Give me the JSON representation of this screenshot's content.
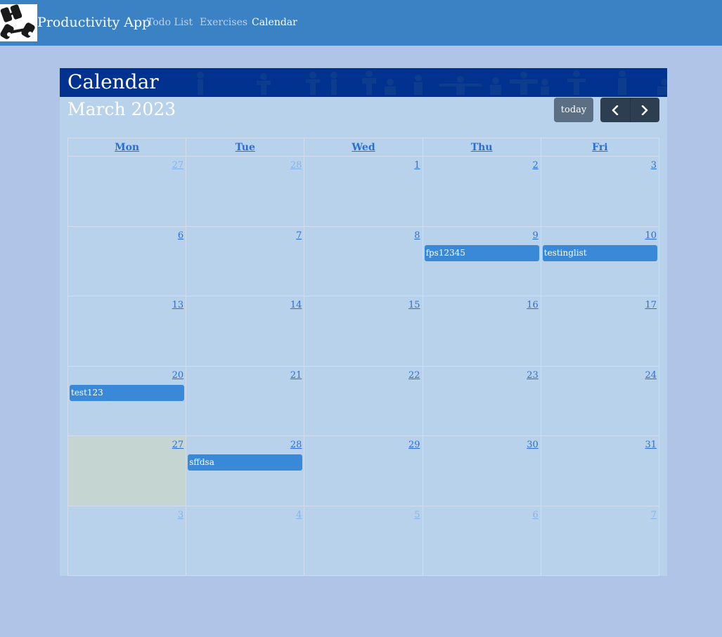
{
  "app": {
    "brand": "Productivity App"
  },
  "nav": {
    "links": [
      {
        "label": "Todo List",
        "active": false
      },
      {
        "label": "Exercises",
        "active": false
      },
      {
        "label": "Calendar",
        "active": true
      }
    ]
  },
  "banner": {
    "title": "Calendar"
  },
  "calendar": {
    "month_title": "March 2023",
    "today_label": "today",
    "prev_icon": "chevron-left-icon",
    "next_icon": "chevron-right-icon",
    "weekdays": [
      "Mon",
      "Tue",
      "Wed",
      "Thu",
      "Fri"
    ],
    "weeks": [
      [
        {
          "day": "27",
          "other": true
        },
        {
          "day": "28",
          "other": true
        },
        {
          "day": "1"
        },
        {
          "day": "2"
        },
        {
          "day": "3"
        }
      ],
      [
        {
          "day": "6"
        },
        {
          "day": "7"
        },
        {
          "day": "8"
        },
        {
          "day": "9",
          "event": "fps12345"
        },
        {
          "day": "10",
          "event": "testinglist"
        }
      ],
      [
        {
          "day": "13"
        },
        {
          "day": "14"
        },
        {
          "day": "15"
        },
        {
          "day": "16"
        },
        {
          "day": "17"
        }
      ],
      [
        {
          "day": "20",
          "event": "test123"
        },
        {
          "day": "21"
        },
        {
          "day": "22"
        },
        {
          "day": "23"
        },
        {
          "day": "24"
        }
      ],
      [
        {
          "day": "27",
          "today": true
        },
        {
          "day": "28",
          "event": "sffdsa"
        },
        {
          "day": "29"
        },
        {
          "day": "30"
        },
        {
          "day": "31"
        }
      ],
      [
        {
          "day": "3",
          "other": true
        },
        {
          "day": "4",
          "other": true
        },
        {
          "day": "5",
          "other": true
        },
        {
          "day": "6",
          "other": true
        },
        {
          "day": "7",
          "other": true
        }
      ]
    ]
  },
  "colors": {
    "navbar": "#3b82c4",
    "banner": "#023290",
    "event": "#3a88d8",
    "today_cell": "#c5d5d2",
    "link": "#2a6fd6"
  }
}
